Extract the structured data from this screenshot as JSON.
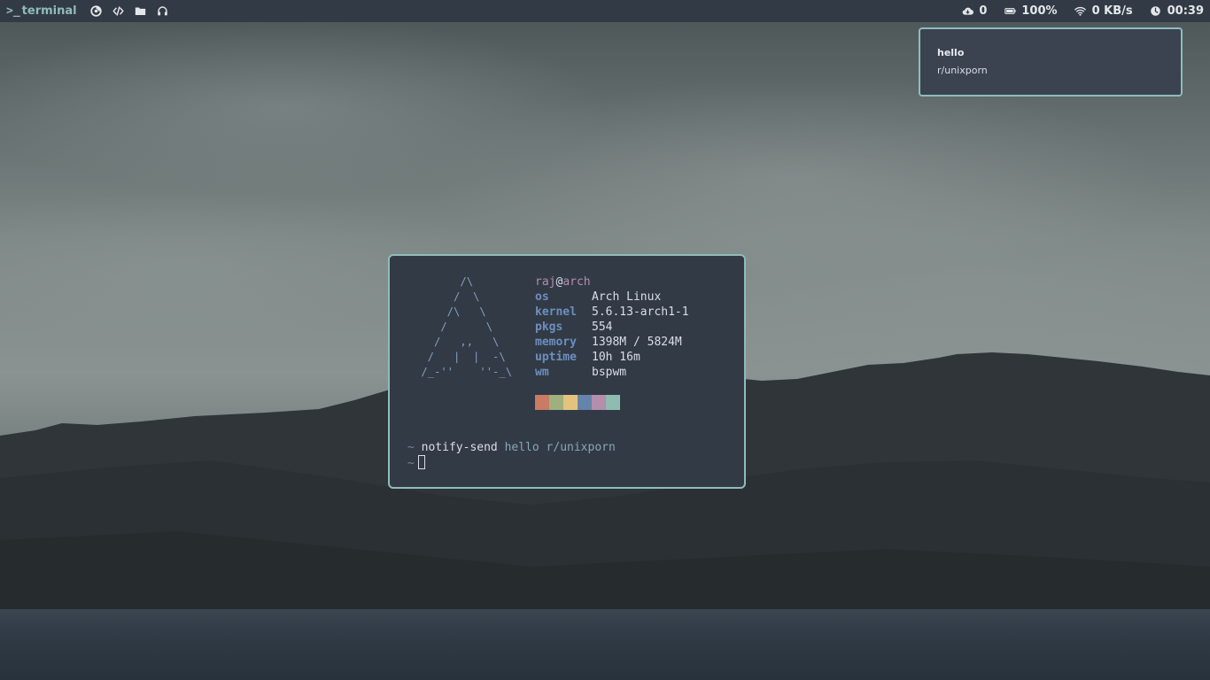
{
  "topbar": {
    "workspace": {
      "prompt": ">_",
      "label": "terminal"
    },
    "left_icons": [
      "firefox-icon",
      "code-icon",
      "folder-icon",
      "headphones-icon"
    ],
    "updates": {
      "icon": "cloud-download-icon",
      "value": "0"
    },
    "battery": {
      "icon": "battery-icon",
      "value": "100%"
    },
    "network": {
      "icon": "wifi-icon",
      "value": "0 KB/s"
    },
    "clock": {
      "icon": "clock-icon",
      "value": "00:39"
    }
  },
  "notification": {
    "title": "hello",
    "body": "r/unixporn"
  },
  "terminal": {
    "ascii_logo": "       /\\\n      /  \\\n     /\\   \\\n    /      \\\n   /   ,,   \\\n  /   |  |  -\\\n /_-''    ''-_\\",
    "user": "raj",
    "at": "@",
    "host": "arch",
    "info": [
      {
        "key": "os",
        "value": "Arch Linux"
      },
      {
        "key": "kernel",
        "value": "5.6.13-arch1-1"
      },
      {
        "key": "pkgs",
        "value": "554"
      },
      {
        "key": "memory",
        "value": "1398M / 5824M"
      },
      {
        "key": "uptime",
        "value": "10h 16m"
      },
      {
        "key": "wm",
        "value": "bspwm"
      }
    ],
    "palette": [
      "#c97b63",
      "#9fb07f",
      "#e4c47d",
      "#6683aa",
      "#b48ead",
      "#8fbcb0"
    ],
    "prompt_symbol": "~",
    "command": "notify-send",
    "command_args": "hello r/unixporn"
  },
  "colors": {
    "accent": "#8fbcbb",
    "bar_bg": "#323a45",
    "term_bg": "#323a45"
  }
}
